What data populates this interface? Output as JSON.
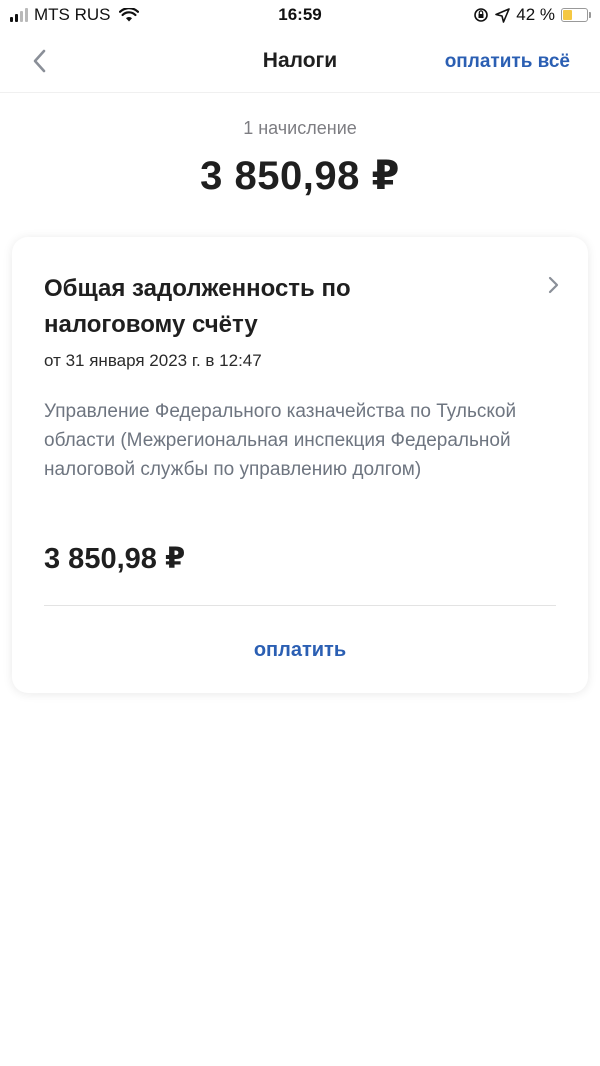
{
  "status_bar": {
    "carrier": "MTS RUS",
    "time": "16:59",
    "battery_percent": "42 %",
    "battery_level": 0.42
  },
  "nav": {
    "title": "Налоги",
    "pay_all_label": "оплатить всё"
  },
  "summary": {
    "charges_count": "1 начисление",
    "total": "3 850,98 ₽"
  },
  "charge": {
    "title": "Общая задолженность по налоговому счёту",
    "date": "от 31 января 2023 г. в 12:47",
    "recipient": "Управление Федерального казначейства по Тульской области (Межрегиональная инспекция Федеральной налоговой службы по управлению долгом)",
    "amount": "3 850,98 ₽",
    "pay_label": "оплатить"
  },
  "colors": {
    "accent": "#2b5fb3",
    "muted_text": "#7d7d82",
    "battery_fill": "#f5c842"
  }
}
